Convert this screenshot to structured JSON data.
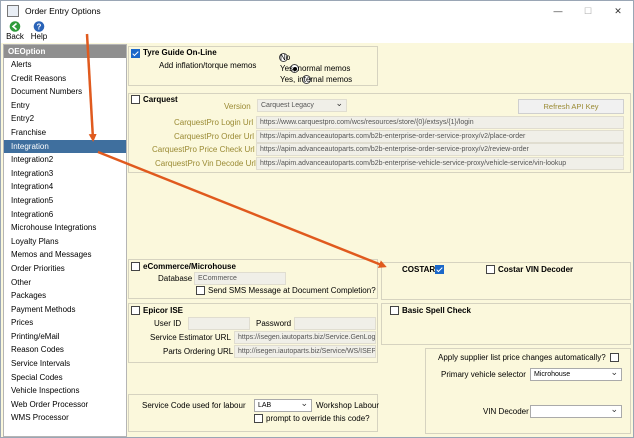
{
  "window": {
    "title": "Order Entry Options",
    "controls": [
      "—",
      "☐",
      "✕"
    ]
  },
  "toolbar": {
    "back": "Back",
    "help": "Help"
  },
  "sidebar": {
    "header": "OEOption",
    "items": [
      "Alerts",
      "Credit Reasons",
      "Document Numbers",
      "Entry",
      "Entry2",
      "Franchise",
      "Integration",
      "Integration2",
      "Integration3",
      "Integration4",
      "Integration5",
      "Integration6",
      "Microhouse Integrations",
      "Loyalty Plans",
      "Memos and Messages",
      "Order Priorities",
      "Other",
      "Packages",
      "Payment Methods",
      "Prices",
      "Printing/eMail",
      "Reason Codes",
      "Service Intervals",
      "Special Codes",
      "Vehicle Inspections",
      "Web Order Processor",
      "WMS Processor"
    ],
    "selected_index": 6
  },
  "tyre_guide": {
    "title": "Tyre Guide On-Line",
    "checked": true,
    "memos_label": "Add inflation/torque memos",
    "options": [
      "No",
      "Yes, normal memos",
      "Yes, internal memos"
    ],
    "selected_option": 1
  },
  "carquest": {
    "title": "Carquest",
    "checked": false,
    "version_label": "Version",
    "version_value": "Carquest Legacy",
    "refresh_button": "Refresh API Key",
    "login_label": "CarquestPro Login Url",
    "login_value": "https://www.carquestpro.com/wcs/resources/store/{0}/extsys/{1}/login",
    "order_label": "CarquestPro Order Url",
    "order_value": "https://apim.advanceautoparts.com/b2b-enterprise-order-service-proxy/v2/place-order",
    "price_label": "CarquestPro Price Check Url",
    "price_value": "https://apim.advanceautoparts.com/b2b-enterprise-order-service-proxy/v2/review-order",
    "vin_label": "CarquestPro Vin Decode Url",
    "vin_value": "https://apim.advanceautoparts.com/b2b-enterprise-vehicle-service-proxy/vehicle-service/vin-lookup"
  },
  "ecommerce": {
    "title": "eCommerce/Microhouse",
    "checked": false,
    "database_label": "Database",
    "database_value": "ECommerce",
    "sms_label": "Send SMS Message at Document Completion?",
    "sms_checked": false
  },
  "costar": {
    "title": "COSTAR",
    "checked": true,
    "vin_title": "Costar VIN Decoder",
    "vin_checked": false
  },
  "epicor": {
    "title": "Epicor ISE",
    "checked": false,
    "user_label": "User ID",
    "user_value": "",
    "password_label": "Password",
    "password_value": "",
    "estimator_label": "Service Estimator URL",
    "estimator_value": "https://isegen.iautoparts.biz/Service.GenLogin",
    "parts_label": "Parts Ordering URL",
    "parts_value": "http://isegen.iautoparts.biz/Service/WS/ISEP"
  },
  "spell": {
    "title": "Basic Spell Check",
    "checked": false
  },
  "supplier": {
    "apply_label": "Apply supplier list price changes automatically?",
    "apply_checked": false,
    "primary_label": "Primary vehicle selector",
    "primary_value": "Microhouse",
    "vin_label": "VIN Decoder",
    "vin_value": ""
  },
  "service": {
    "code_label": "Service Code used for labour",
    "code_value": "LAB",
    "code_desc": "Workshop Labour",
    "prompt_label": "prompt to override this code?",
    "prompt_checked": false
  },
  "colors": {
    "selected": "#3f6f9e",
    "check": "#1b68c9",
    "arrow": "#e05a1e",
    "panel": "#fbf8dc",
    "label_olive": "#9a8a33"
  }
}
